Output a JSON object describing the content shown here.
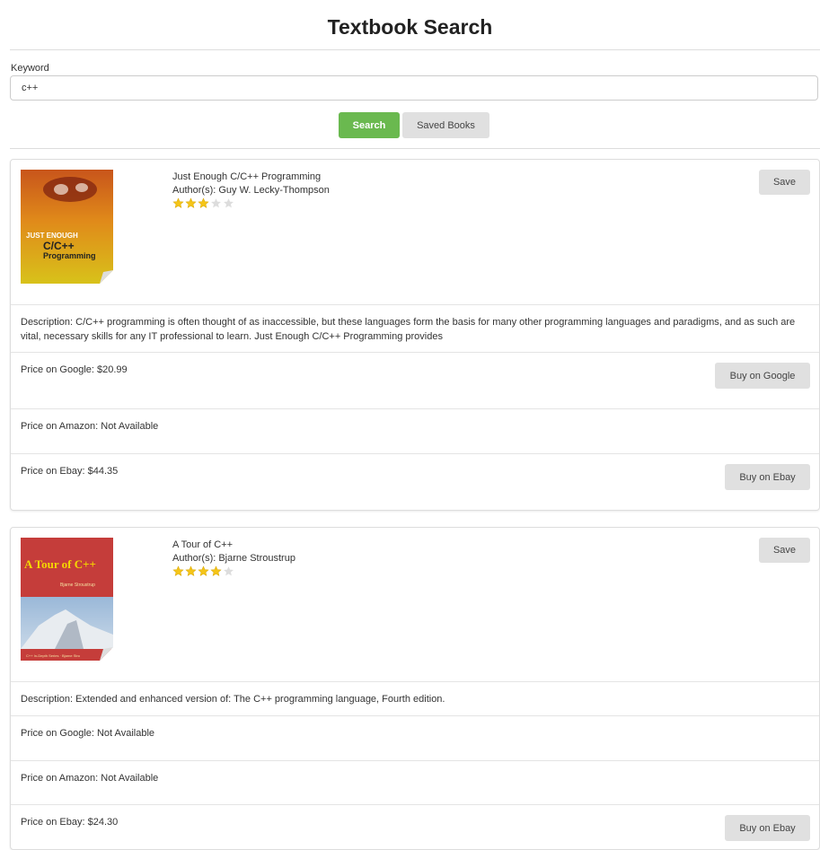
{
  "page": {
    "title": "Textbook Search"
  },
  "search": {
    "label": "Keyword",
    "value": "c++",
    "search_button": "Search",
    "saved_button": "Saved Books"
  },
  "colors": {
    "accent": "#6ab94f",
    "button_grey": "#e0e0e0",
    "star": "#f5c518"
  },
  "books": [
    {
      "title": "Just Enough C/C++ Programming",
      "authors": "Author(s): Guy W. Lecky-Thompson",
      "rating": 3,
      "rating_max": 5,
      "save_label": "Save",
      "cover_text": [
        "JUST ENOUGH",
        "C/C++",
        "Programming"
      ],
      "description": "Description: C/C++ programming is often thought of as inaccessible, but these languages form the basis for many other programming languages and paradigms, and as such are vital, necessary skills for any IT professional to learn. Just Enough C/C++ Programming provides",
      "price_google": "Price on Google: $20.99",
      "buy_google": "Buy on Google",
      "price_amazon": "Price on Amazon: Not Available",
      "price_ebay": "Price on Ebay: $44.35",
      "buy_ebay": "Buy on Ebay"
    },
    {
      "title": "A Tour of C++",
      "authors": "Author(s): Bjarne Stroustrup",
      "rating": 4,
      "rating_max": 5,
      "save_label": "Save",
      "cover_text": [
        "A Tour of C++",
        "Bjarne Stroustrup",
        "C++ In-Depth Series · Bjarne Stro"
      ],
      "description": "Description: Extended and enhanced version of: The C++ programming language, Fourth edition.",
      "price_google": "Price on Google: Not Available",
      "price_amazon": "Price on Amazon: Not Available",
      "price_ebay": "Price on Ebay: $24.30",
      "buy_ebay": "Buy on Ebay"
    }
  ]
}
